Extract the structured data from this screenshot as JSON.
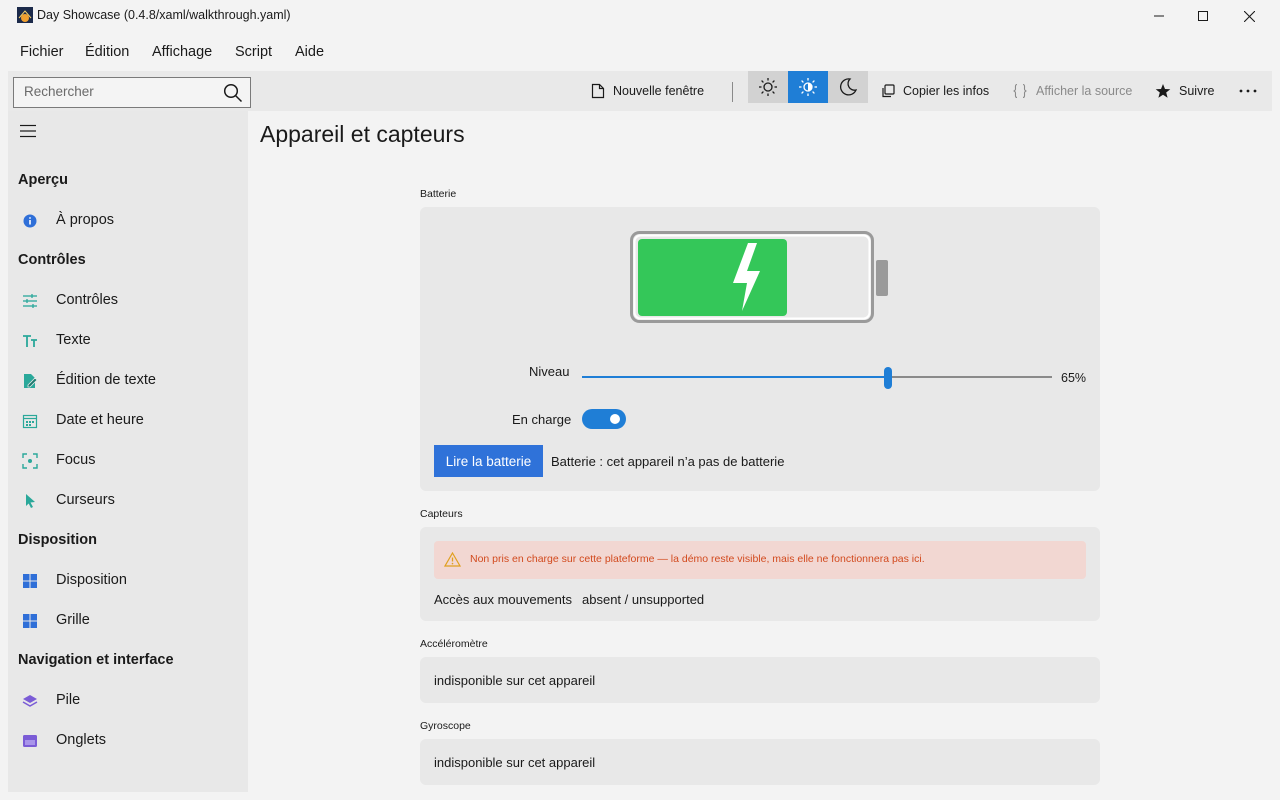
{
  "window": {
    "title": "Day Showcase (0.4.8/xaml/walkthrough.yaml)"
  },
  "menu": [
    "Fichier",
    "Édition",
    "Affichage",
    "Script",
    "Aide"
  ],
  "toolbar": {
    "search_placeholder": "Rechercher",
    "new_window": "Nouvelle fenêtre",
    "copy_info": "Copier les infos",
    "show_source": "Afficher la source",
    "follow": "Suivre"
  },
  "sidebar": {
    "sections": [
      {
        "header": "Aperçu",
        "items": [
          {
            "label": "À propos",
            "icon": "info-icon"
          }
        ]
      },
      {
        "header": "Contrôles",
        "items": [
          {
            "label": "Contrôles",
            "icon": "sliders-icon"
          },
          {
            "label": "Texte",
            "icon": "text-icon"
          },
          {
            "label": "Édition de texte",
            "icon": "edit-icon"
          },
          {
            "label": "Date et heure",
            "icon": "calendar-icon"
          },
          {
            "label": "Focus",
            "icon": "focus-icon"
          },
          {
            "label": "Curseurs",
            "icon": "cursor-icon"
          }
        ]
      },
      {
        "header": "Disposition",
        "items": [
          {
            "label": "Disposition",
            "icon": "layout-icon"
          },
          {
            "label": "Grille",
            "icon": "grid-icon"
          }
        ]
      },
      {
        "header": "Navigation et interface",
        "items": [
          {
            "label": "Pile",
            "icon": "stack-icon"
          },
          {
            "label": "Onglets",
            "icon": "tabs-icon"
          }
        ]
      }
    ]
  },
  "page": {
    "title": "Appareil et capteurs",
    "battery": {
      "section_label": "Batterie",
      "level_label": "Niveau",
      "level_value": 65,
      "level_text": "65%",
      "charging_label": "En charge",
      "charging": true,
      "read_button": "Lire la batterie",
      "read_result": "Batterie : cet appareil n’a pas de batterie"
    },
    "sensors": {
      "section_label": "Capteurs",
      "warning": "Non pris en charge sur cette plateforme — la démo reste visible, mais elle ne fonctionnera pas ici.",
      "motion_label": "Accès aux mouvements",
      "motion_value": "absent / unsupported"
    },
    "accelerometer": {
      "section_label": "Accéléromètre",
      "value": "indisponible sur cet appareil"
    },
    "gyroscope": {
      "section_label": "Gyroscope",
      "value": "indisponible sur cet appareil"
    }
  },
  "colors": {
    "accent": "#1f7ed6",
    "battery_fill": "#34c759",
    "warning_text": "#d24a1e",
    "warning_bg": "#f2d7d2"
  }
}
